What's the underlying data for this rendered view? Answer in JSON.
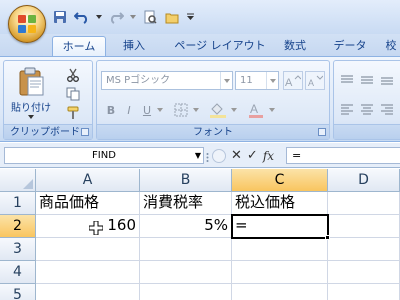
{
  "tabs": [
    {
      "label": "ホーム"
    },
    {
      "label": "挿入"
    },
    {
      "label": "ページ レイアウト"
    },
    {
      "label": "数式"
    },
    {
      "label": "データ"
    },
    {
      "label": "校"
    }
  ],
  "ribbon": {
    "paste_label": "貼り付け",
    "clipboard_label": "クリップボード",
    "font_label": "フォント",
    "font_name": "MS Pゴシック",
    "font_size": "11",
    "bold": "B",
    "italic": "I",
    "underline": "U"
  },
  "formula_bar": {
    "name_box": "FIND",
    "cancel": "✕",
    "enter": "✓",
    "fx": "fx",
    "formula": "="
  },
  "sheet": {
    "columns": [
      "A",
      "B",
      "C",
      "D"
    ],
    "rows": [
      "1",
      "2",
      "3",
      "4",
      "5"
    ],
    "cells": {
      "A1": "商品価格",
      "B1": "消費税率",
      "C1": "税込価格",
      "A2": "160",
      "B2": "5%",
      "C2": "="
    },
    "active_column": "C",
    "active_row": "2"
  },
  "colors": {
    "accent": "#15428b",
    "selected_header": "#f9c55f",
    "gridline": "#d0d7e5"
  }
}
